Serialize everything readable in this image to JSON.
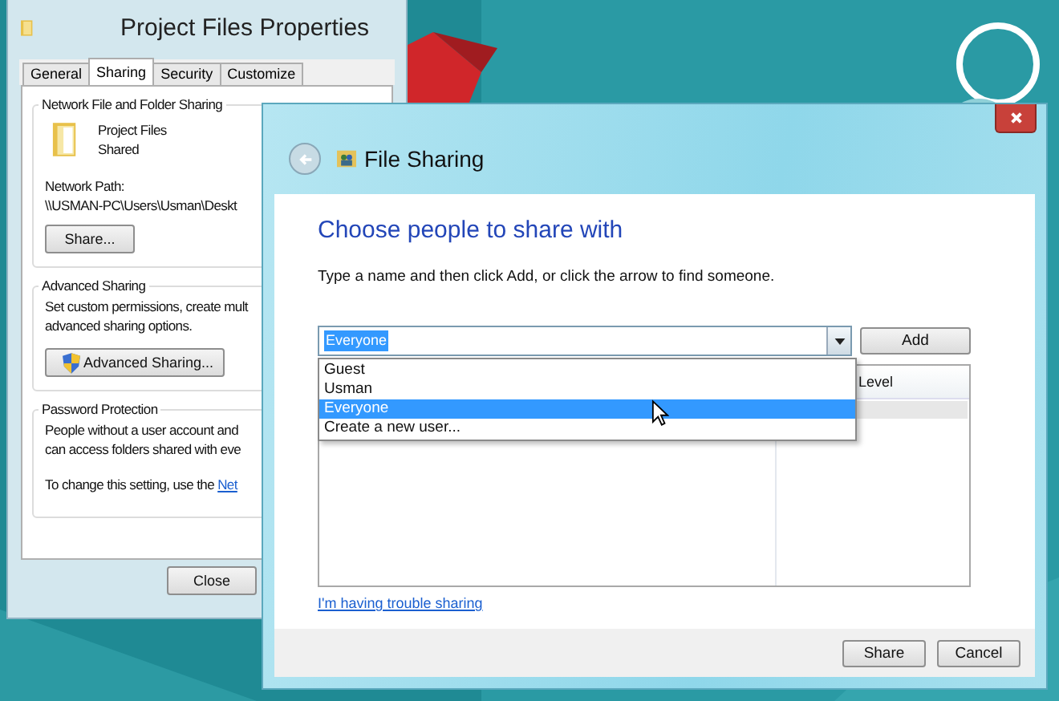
{
  "properties_window": {
    "title": "Project Files Properties",
    "tabs": [
      {
        "label": "General",
        "selected": false
      },
      {
        "label": "Sharing",
        "selected": true
      },
      {
        "label": "Security",
        "selected": false
      },
      {
        "label": "Customize",
        "selected": false
      }
    ],
    "network_sharing": {
      "heading": "Network File and Folder Sharing",
      "folder_name": "Project Files",
      "folder_status": "Shared",
      "path_label": "Network Path:",
      "path": "\\\\USMAN-PC\\Users\\Usman\\Deskt",
      "button": "Share..."
    },
    "advanced_sharing": {
      "heading": "Advanced Sharing",
      "lines": [
        "Set custom permissions, create mult",
        "advanced sharing options."
      ],
      "button": "Advanced Sharing..."
    },
    "password_protection": {
      "heading": "Password Protection",
      "lines": [
        "People without a user account and",
        "can access folders shared with eve"
      ],
      "change_text": "To change this setting, use the",
      "link": "Net"
    },
    "close_button": "Close"
  },
  "file_sharing": {
    "title": "File Sharing",
    "heading": "Choose people to share with",
    "instruction": "Type a name and then click Add, or click the arrow to find someone.",
    "combo": {
      "value": "Everyone"
    },
    "add_button": "Add",
    "dropdown": [
      {
        "label": "Guest",
        "selected": false
      },
      {
        "label": "Usman",
        "selected": false
      },
      {
        "label": "Everyone",
        "selected": true
      },
      {
        "label": "Create a new user...",
        "selected": false
      }
    ],
    "table": {
      "columns": [
        "Level"
      ]
    },
    "help_link": "I'm having trouble sharing",
    "buttons": [
      "Share",
      "Cancel"
    ]
  }
}
